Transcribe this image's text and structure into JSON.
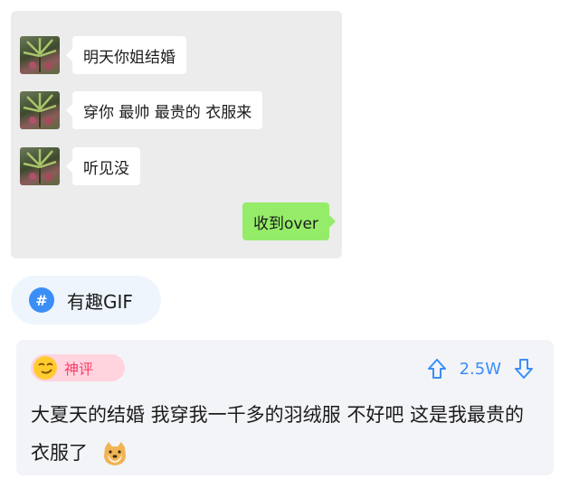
{
  "chat": {
    "messages": [
      {
        "side": "received",
        "text": "明天你姐结婚"
      },
      {
        "side": "received",
        "text": "穿你 最帅 最贵的 衣服来"
      },
      {
        "side": "received",
        "text": "听见没"
      },
      {
        "side": "sent",
        "text": "收到over"
      }
    ]
  },
  "topic": {
    "icon": "hash-icon",
    "symbol": "#",
    "label": "有趣GIF"
  },
  "comment": {
    "badge_label": "神评",
    "vote_count": "2.5W",
    "text": "大夏天的结婚  我穿我一千多的羽绒服 不好吧 这是我最贵的衣服了"
  },
  "colors": {
    "accent_blue": "#3a8ef6",
    "sent_bubble": "#95ec69",
    "badge_pink": "#ff3b64"
  }
}
